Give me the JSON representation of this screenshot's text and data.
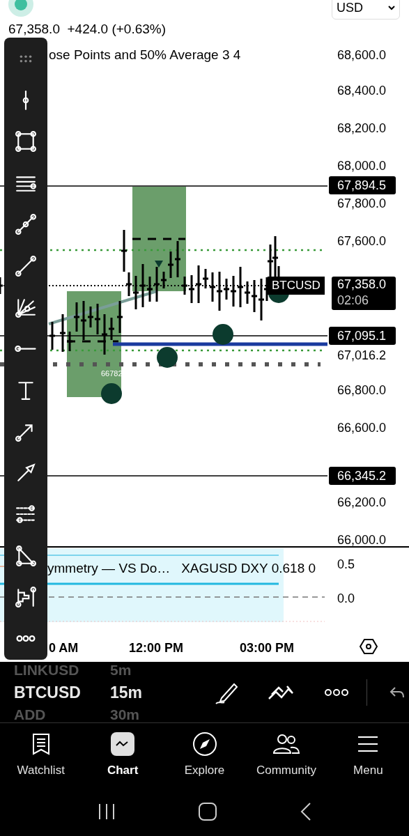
{
  "header": {
    "quote": "67,358.0  +424.0 (+0.63%)",
    "currency": "USD",
    "indicator": "ose Points and 50% Average 3 4"
  },
  "price_axis": [
    "68,600.0",
    "68,400.0",
    "68,200.0",
    "68,000.0",
    "67,800.0",
    "67,600.0",
    "66,800.0",
    "66,600.0",
    "66,200.0",
    "66,000.0"
  ],
  "price_tags": [
    {
      "kind": "tag",
      "price": "67,894.5"
    },
    {
      "kind": "last",
      "price": "67,358.0",
      "countdown": "02:06",
      "symbol": "BTCUSD"
    },
    {
      "kind": "tag",
      "price": "67,095.1"
    },
    {
      "kind": "plain",
      "price": "67,016.2"
    },
    {
      "kind": "tag",
      "price": "66,345.2"
    }
  ],
  "chart_label": "66782",
  "indicator_pane": {
    "legend": "ymmetry — VS Do…   XAGUSD DXY 0.618 0",
    "axis": [
      "0.5",
      "0.0"
    ]
  },
  "time_axis": [
    "0 AM",
    "12:00 PM",
    "03:00 PM"
  ],
  "symbol_picker": [
    {
      "symbol": "LINKUSD",
      "interval": "5m",
      "selected": false
    },
    {
      "symbol": "BTCUSD",
      "interval": "15m",
      "selected": true
    },
    {
      "symbol": "ADD",
      "interval": "30m",
      "selected": false
    }
  ],
  "nav": [
    {
      "label": "Watchlist",
      "selected": false
    },
    {
      "label": "Chart",
      "selected": true
    },
    {
      "label": "Explore",
      "selected": false
    },
    {
      "label": "Community",
      "selected": false
    },
    {
      "label": "Menu",
      "selected": false
    }
  ]
}
